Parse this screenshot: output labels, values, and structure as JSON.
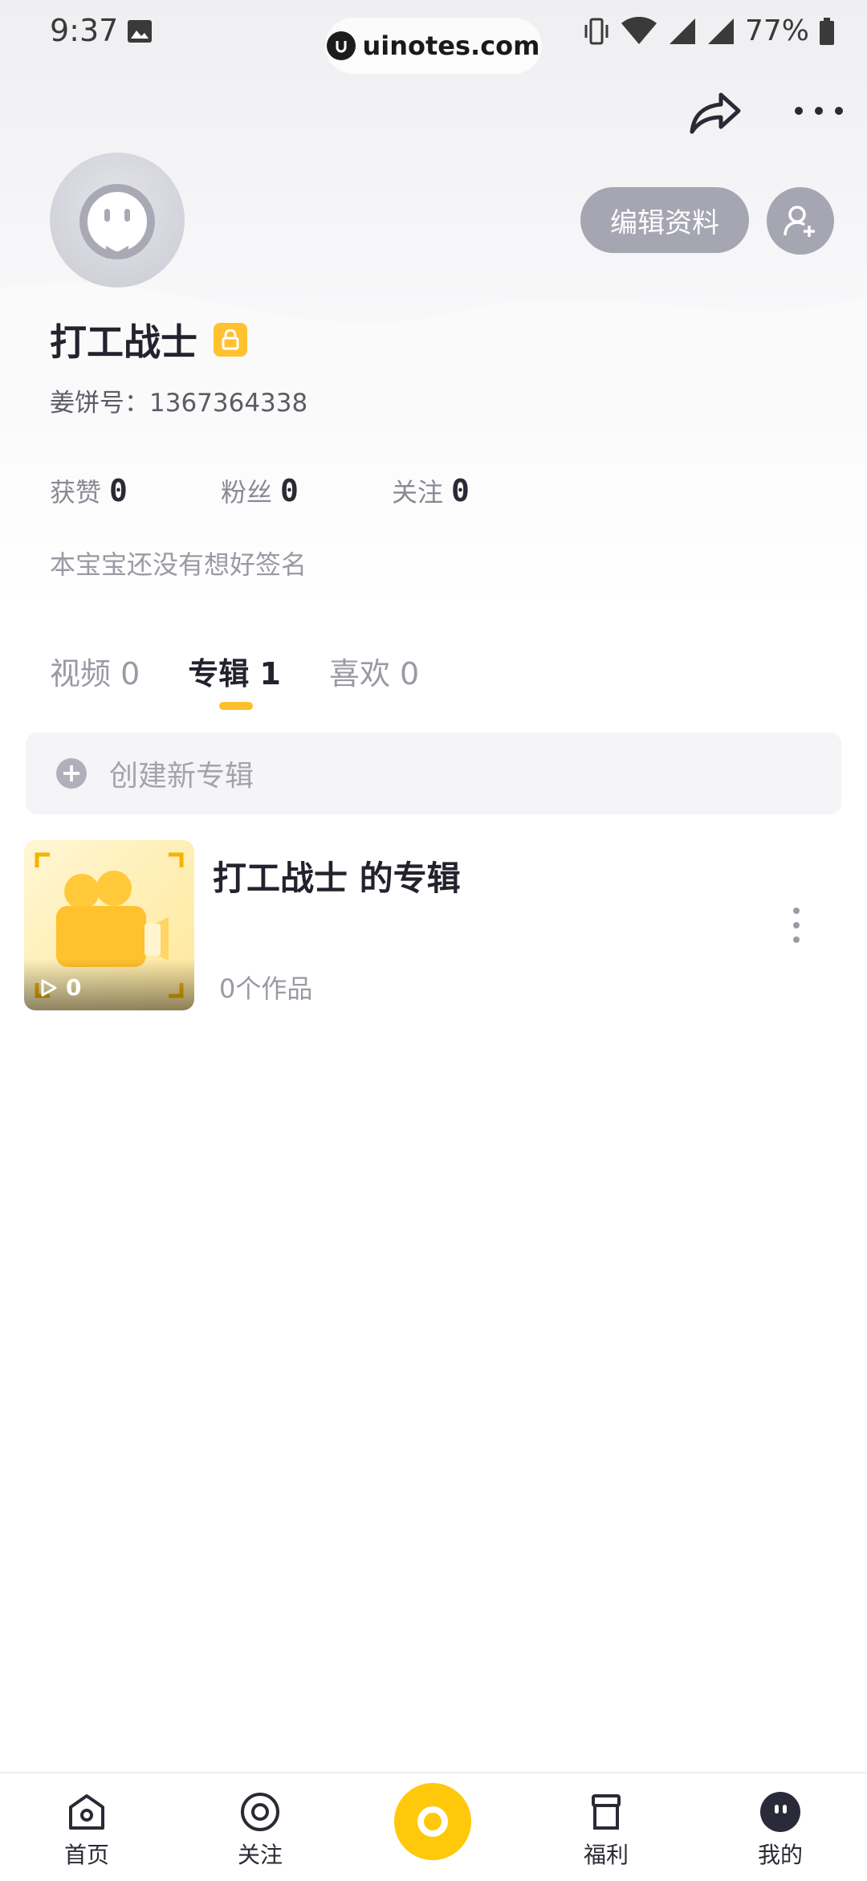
{
  "status_bar": {
    "time": "9:37",
    "url": "uinotes.com",
    "battery": "77%"
  },
  "profile": {
    "username": "打工战士",
    "user_id": "姜饼号：1367364338",
    "edit_label": "编辑资料",
    "bio": "本宝宝还没有想好签名"
  },
  "stats": [
    {
      "label": "获赞",
      "value": "0"
    },
    {
      "label": "粉丝",
      "value": "0"
    },
    {
      "label": "关注",
      "value": "0"
    }
  ],
  "tabs": [
    {
      "label": "视频 0"
    },
    {
      "label": "专辑 1"
    },
    {
      "label": "喜欢 0"
    }
  ],
  "create_album": {
    "label": "创建新专辑"
  },
  "album": {
    "title": "打工战士 的专辑",
    "works": "0个作品",
    "play_count": "0"
  },
  "bottom_nav": [
    {
      "label": "首页"
    },
    {
      "label": "关注"
    },
    {
      "label": ""
    },
    {
      "label": "福利"
    },
    {
      "label": "我的"
    }
  ],
  "colors": {
    "accent": "#ffc80a",
    "tab_indicator": "#ffbf2b",
    "button_gray": "#a6a6b3"
  }
}
